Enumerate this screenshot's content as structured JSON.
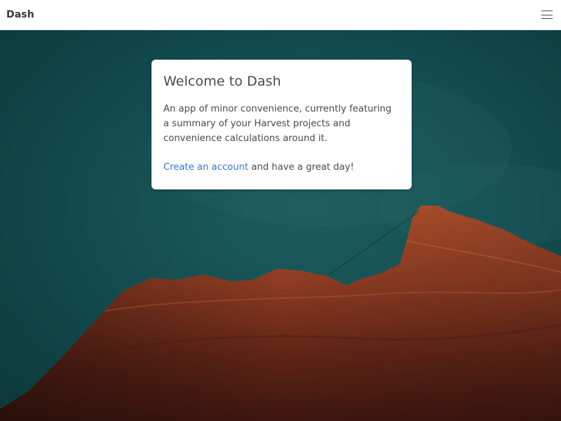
{
  "navbar": {
    "brand": "Dash",
    "menu_icon": "hamburger-menu-icon"
  },
  "hero": {
    "background_image": "mountain-sunset-photo",
    "sky_color": "#0f4548",
    "rock_color": "#8a3a22"
  },
  "welcome_card": {
    "title": "Welcome to Dash",
    "description": "An app of minor convenience, currently featuring a summary of your Harvest projects and convenience calculations around it.",
    "cta_link": "Create an account",
    "cta_suffix": " and have a great day!"
  },
  "colors": {
    "link": "#3273dc",
    "text": "#4a4a4a",
    "brand_text": "#363636"
  }
}
